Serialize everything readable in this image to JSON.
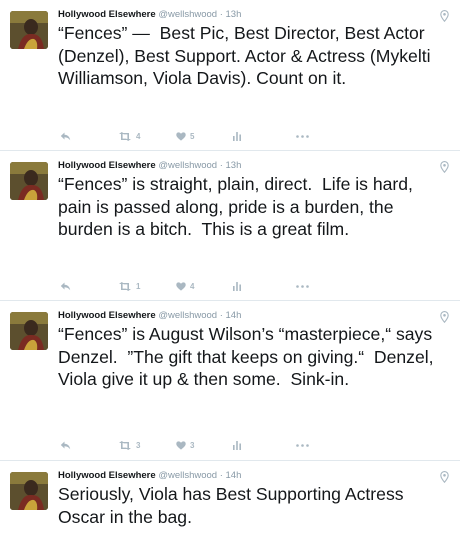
{
  "author": {
    "name": "Hollywood Elsewhere",
    "handle": "@wellshwood"
  },
  "tweets": [
    {
      "time": "· 13h",
      "text": "“Fences” —  Best Pic, Best Director, Best Actor (Denzel), Best Support. Actor & Actress (Mykelti Williamson, Viola Davis). Count on it.",
      "retweets": "4",
      "likes": "5"
    },
    {
      "time": "· 13h",
      "text": "“Fences” is straight, plain, direct.  Life is hard, pain is passed along, pride is a burden, the burden is a bitch.  This is a great film.",
      "retweets": "1",
      "likes": "4"
    },
    {
      "time": "· 14h",
      "text": "“Fences” is August Wilson’s “masterpiece,“ says Denzel.  ”The gift that keeps on giving.“  Denzel, Viola give it up & then some.  Sink-in.",
      "retweets": "3",
      "likes": "3"
    },
    {
      "time": "· 14h",
      "text": "Seriously, Viola has Best Supporting Actress Oscar in the bag.",
      "retweets": "",
      "likes": ""
    }
  ],
  "icons": {
    "reply": "reply-icon",
    "retweet": "retweet-icon",
    "like": "heart-icon",
    "analytics": "analytics-icon",
    "more": "more-icon",
    "location": "location-pin-icon"
  },
  "colors": {
    "action_icon": "#aab8c2",
    "meta_text": "#8899a6",
    "divider": "#e1e8ed"
  }
}
